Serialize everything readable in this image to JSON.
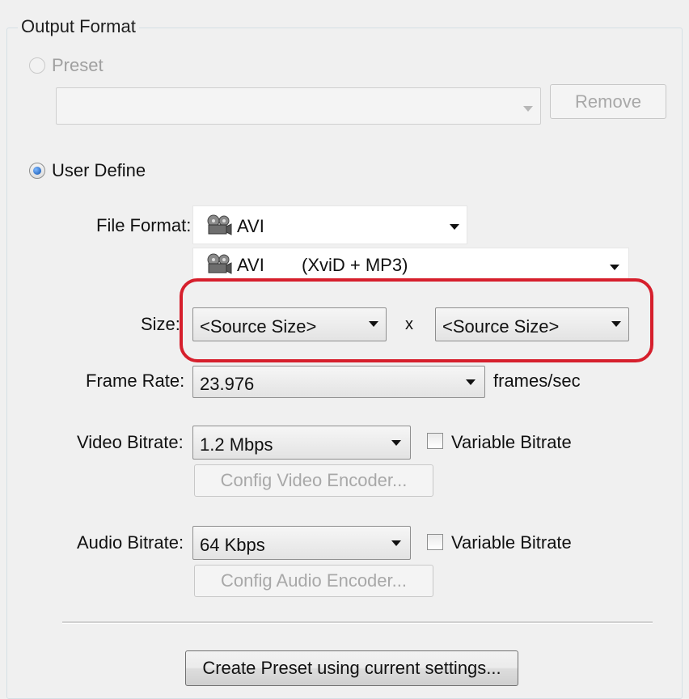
{
  "group": {
    "title": "Output Format"
  },
  "preset": {
    "label": "Preset",
    "selected": false,
    "combo_value": "",
    "remove_label": "Remove"
  },
  "user_define": {
    "label": "User Define",
    "selected": true
  },
  "file_format": {
    "label": "File Format:",
    "value": "AVI",
    "codec_name": "AVI",
    "codec_detail": "(XviD + MP3)",
    "icon": "film-reel-icon"
  },
  "size": {
    "label": "Size:",
    "width_value": "<Source Size>",
    "separator": "x",
    "height_value": "<Source Size>"
  },
  "frame_rate": {
    "label": "Frame Rate:",
    "value": "23.976",
    "unit": "frames/sec"
  },
  "video_bitrate": {
    "label": "Video Bitrate:",
    "value": "1.2 Mbps",
    "variable_label": "Variable Bitrate",
    "variable_checked": false,
    "config_label": "Config Video Encoder..."
  },
  "audio_bitrate": {
    "label": "Audio Bitrate:",
    "value": "64 Kbps",
    "variable_label": "Variable Bitrate",
    "variable_checked": false,
    "config_label": "Config Audio Encoder..."
  },
  "create_preset": {
    "label": "Create Preset using current settings..."
  },
  "colors": {
    "highlight": "#d61f2c",
    "background": "#f0f0f0",
    "radio_selected": "#0c4fad"
  }
}
